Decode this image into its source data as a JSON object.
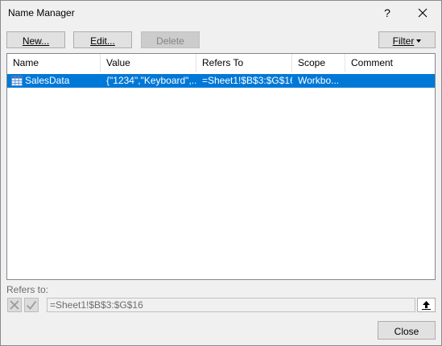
{
  "window": {
    "title": "Name Manager",
    "help_label": "?"
  },
  "toolbar": {
    "new_label": "New...",
    "edit_label": "Edit...",
    "delete_label": "Delete",
    "filter_label": "Filter"
  },
  "table": {
    "columns": [
      "Name",
      "Value",
      "Refers To",
      "Scope",
      "Comment"
    ],
    "rows": [
      {
        "name": "SalesData",
        "value": "{\"1234\",\"Keyboard\",...",
        "refers_to": "=Sheet1!$B$3:$G$16",
        "scope": "Workbo...",
        "comment": "",
        "selected": true
      }
    ]
  },
  "refers_to": {
    "label": "Refers to:",
    "value": "=Sheet1!$B$3:$G$16"
  },
  "footer": {
    "close_label": "Close"
  },
  "colors": {
    "selection": "#0078d7",
    "dialog_bg": "#f0f0f0"
  }
}
